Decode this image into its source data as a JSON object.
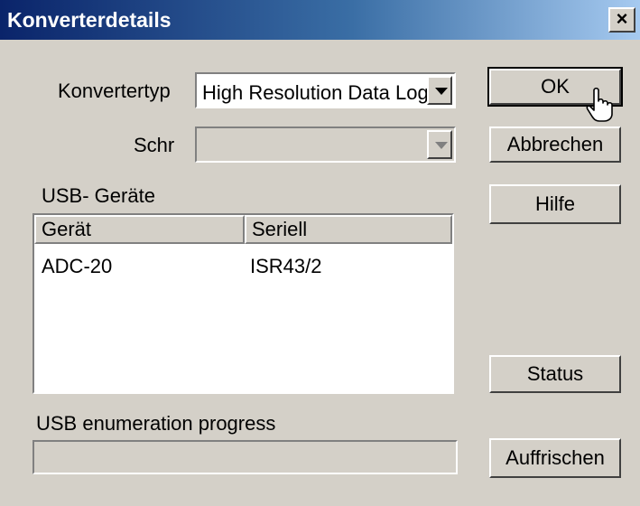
{
  "window": {
    "title": "Konverterdetails",
    "close_glyph": "×"
  },
  "form": {
    "converter_type_label": "Konvertertyp",
    "converter_type_value": "High Resolution Data Log",
    "schr_label": "Schr",
    "schr_value": "",
    "usb_devices_label": "USB- Geräte",
    "progress_label": "USB enumeration progress",
    "progress_value": 0
  },
  "device_list": {
    "columns": [
      "Gerät",
      "Seriell"
    ],
    "rows": [
      {
        "device": "ADC-20",
        "serial": "ISR43/2"
      }
    ]
  },
  "buttons": {
    "ok": "OK",
    "cancel": "Abbrechen",
    "help": "Hilfe",
    "status": "Status",
    "refresh": "Auffrischen"
  }
}
